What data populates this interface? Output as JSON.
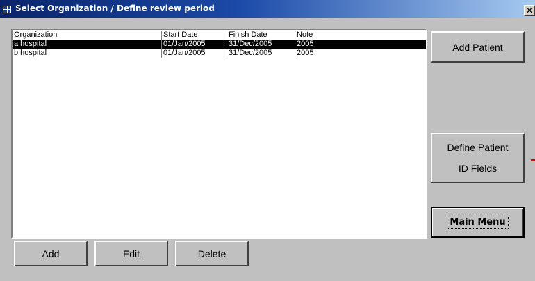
{
  "window": {
    "title": "Select Organization / Define review period",
    "close_label": "✕",
    "background_color": "#c0c0c0",
    "titlebar_color": "#0a246a"
  },
  "list": {
    "columns": [
      "Organization",
      "Start Date",
      "Finish Date",
      "Note"
    ],
    "rows": [
      {
        "organization": "a hospital",
        "start": "01/Jan/2005",
        "finish": "31/Dec/2005",
        "note": "2005",
        "selected": true
      },
      {
        "organization": "b hospital",
        "start": "01/Jan/2005",
        "finish": "31/Dec/2005",
        "note": "2005",
        "selected": false
      }
    ]
  },
  "buttons": {
    "add_patient": "Add Patient",
    "define_line1": "Define Patient",
    "define_line2": "ID Fields",
    "main_menu": "Main Menu",
    "add": "Add",
    "edit": "Edit",
    "delete": "Delete"
  }
}
